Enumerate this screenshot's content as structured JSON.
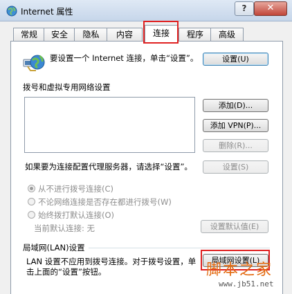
{
  "window": {
    "title": "Internet 属性",
    "help_label": "?",
    "close_label": "✕"
  },
  "tabs": [
    {
      "label": "常规",
      "active": false
    },
    {
      "label": "安全",
      "active": false
    },
    {
      "label": "隐私",
      "active": false
    },
    {
      "label": "内容",
      "active": false
    },
    {
      "label": "连接",
      "active": true
    },
    {
      "label": "程序",
      "active": false
    },
    {
      "label": "高级",
      "active": false
    }
  ],
  "setup": {
    "text": "要设置一个 Internet 连接，单击“设置”。",
    "button": "设置(U)"
  },
  "dialup": {
    "heading": "拨号和虚拟专用网络设置",
    "add_button": "添加(D)...",
    "add_vpn_button": "添加 VPN(P)...",
    "delete_button": "删除(R)...",
    "proxy_text": "如果要为连接配置代理服务器，请选择“设置”。",
    "settings_button": "设置(S)",
    "options": [
      {
        "label": "从不进行拨号连接(C)",
        "selected": true
      },
      {
        "label": "不论网络连接是否存在都进行拨号(W)",
        "selected": false
      },
      {
        "label": "始终拨打默认连接(O)",
        "selected": false
      }
    ],
    "current_default_label": "当前默认连接:",
    "current_default_value": "无",
    "set_default_button": "设置默认值(E)"
  },
  "lan": {
    "heading": "局域网(LAN)设置",
    "text": "LAN 设置不应用到拨号连接。对于拨号设置，单击上面的“设置”按钮。",
    "button": "局域网设置(L)"
  },
  "watermark": {
    "title": "脚本之家",
    "url": "www.jb51.net"
  },
  "colors": {
    "highlight": "#e02020",
    "watermark": "#e36a10"
  }
}
